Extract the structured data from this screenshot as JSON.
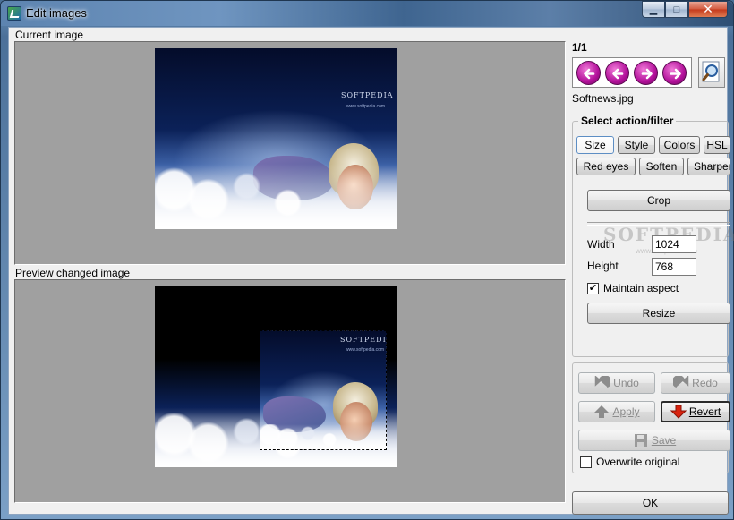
{
  "window": {
    "title": "Edit images",
    "controls": {
      "minimize": "▁",
      "maximize": "□",
      "close": "✕"
    }
  },
  "current_image": {
    "label": "Current image",
    "photo_brand": "SOFTPEDIA",
    "photo_url": "www.softpedia.com"
  },
  "preview": {
    "label": "Preview changed image",
    "photo_brand": "SOFTPEDIA",
    "photo_url": "www.softpedia.com"
  },
  "navigation": {
    "counter": "1/1",
    "buttons": [
      "first-icon",
      "previous-icon",
      "next-icon",
      "last-icon"
    ],
    "zoom_icon": "magnifier-icon",
    "filename": "Softnews.jpg"
  },
  "filter_group": {
    "title": "Select action/filter",
    "tabs_row1": [
      "Size",
      "Style",
      "Colors",
      "HSL"
    ],
    "tabs_row2": [
      "Red eyes",
      "Soften",
      "Sharpen"
    ],
    "selected_tab": "Size",
    "crop_label": "Crop",
    "width_label": "Width",
    "width_value": "1024",
    "height_label": "Height",
    "height_value": "768",
    "maintain_aspect_label": "Maintain aspect",
    "maintain_aspect_checked": true,
    "resize_label": "Resize",
    "watermark_brand": "SOFTPEDIA",
    "watermark_url": "www.softpedia.com"
  },
  "actions": {
    "undo_label": "Undo",
    "redo_label": "Redo",
    "apply_label": "Apply",
    "revert_label": "Revert",
    "save_label": "Save",
    "overwrite_label": "Overwrite original",
    "overwrite_checked": false,
    "ok_label": "OK"
  },
  "colors": {
    "panel_gray": "#a0a0a0",
    "nav_magenta": "#b3109a",
    "revert_arrow": "#d9230f",
    "apply_arrow": "#3c8c3c"
  }
}
